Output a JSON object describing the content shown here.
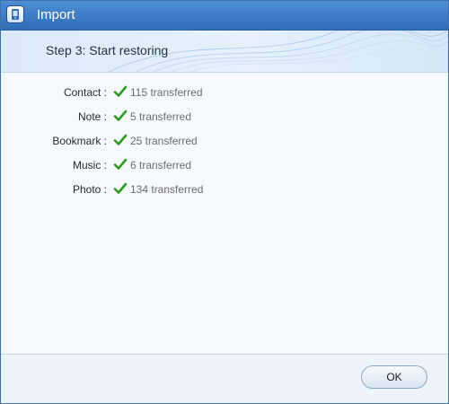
{
  "window": {
    "title": "Import",
    "app_icon": "phone-transfer-icon"
  },
  "banner": {
    "step_text": "Step 3: Start restoring"
  },
  "results": [
    {
      "label": "Contact :",
      "value": "115 transferred",
      "icon": "checkmark-icon"
    },
    {
      "label": "Note :",
      "value": "5 transferred",
      "icon": "checkmark-icon"
    },
    {
      "label": "Bookmark :",
      "value": "25 transferred",
      "icon": "checkmark-icon"
    },
    {
      "label": "Music :",
      "value": "6 transferred",
      "icon": "checkmark-icon"
    },
    {
      "label": "Photo :",
      "value": "134 transferred",
      "icon": "checkmark-icon"
    }
  ],
  "footer": {
    "ok_label": "OK"
  },
  "colors": {
    "titlebar": "#2f6cb6",
    "check": "#2a9d1f"
  }
}
